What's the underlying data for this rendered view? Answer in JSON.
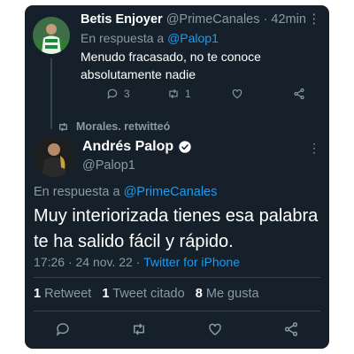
{
  "reply_tweet": {
    "display_name": "Betis Enjoyer",
    "handle": "@PrimeCanales",
    "separator": "·",
    "time": "42min",
    "more": "⋮",
    "reply_prefix": "En respuesta a",
    "reply_to": "@Palop1",
    "text": "Menudo fracasado, no te conoce absolutamente nadie",
    "reply_count": "3",
    "retweet_count": "1"
  },
  "retweet_banner": {
    "text": "Morales. retwitteó"
  },
  "main_tweet": {
    "display_name": "Andrés Palop",
    "verified_icon": "verified-badge-icon",
    "handle": "@Palop1",
    "more": "⋮",
    "reply_prefix": "En respuesta a",
    "reply_to": "@PrimeCanales",
    "text": "Muy interiorizada tienes esa palabra te ha salido fácil y rápido.",
    "time": "17:26",
    "separator": "·",
    "date": "24 nov. 22",
    "source": "Twitter for iPhone",
    "stats": {
      "retweets_count": "1",
      "retweets_label": "Retweet",
      "quotes_count": "1",
      "quotes_label": "Tweet citado",
      "likes_count": "8",
      "likes_label": "Me gusta"
    }
  },
  "colors": {
    "background": "#15202b",
    "text": "#ffffff",
    "secondary": "#8b98a5",
    "accent": "#1d9bf0",
    "divider": "#38444d"
  }
}
